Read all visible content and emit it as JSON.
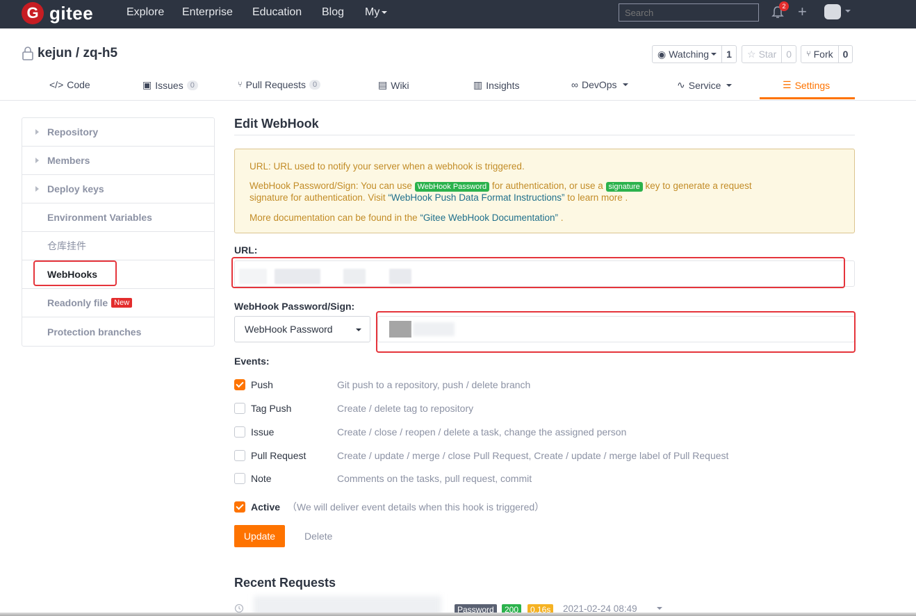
{
  "nav": {
    "logo_text": "gitee",
    "links": [
      "Explore",
      "Enterprise",
      "Education",
      "Blog",
      "My"
    ],
    "search_placeholder": "Search",
    "notification_count": "2"
  },
  "repo": {
    "owner": "kejun",
    "name": "zq-h5",
    "watching_label": "Watching",
    "watching_count": "1",
    "star_label": "Star",
    "star_count": "0",
    "fork_label": "Fork",
    "fork_count": "0"
  },
  "tabs": {
    "code": "Code",
    "issues": "Issues",
    "issues_count": "0",
    "pull_requests": "Pull Requests",
    "pr_count": "0",
    "wiki": "Wiki",
    "insights": "Insights",
    "devops": "DevOps",
    "service": "Service",
    "settings": "Settings"
  },
  "sidebar": {
    "items": [
      {
        "label": "Repository"
      },
      {
        "label": "Members"
      },
      {
        "label": "Deploy keys"
      },
      {
        "label": "Environment Variables"
      },
      {
        "label": "仓库挂件"
      },
      {
        "label": "WebHooks"
      },
      {
        "label": "Readonly file"
      },
      {
        "label": "Protection branches"
      }
    ],
    "new_badge": "New"
  },
  "main": {
    "title": "Edit WebHook",
    "notice": {
      "line1": "URL: URL used to notify your server when a webhook is triggered.",
      "line2_a": "WebHook Password/Sign: You can use",
      "line2_tag1": "WebHook Password",
      "line2_b": "for authentication, or use a",
      "line2_tag2": "signature",
      "line2_c": "key to generate a request",
      "line3_a": "signature for authentication. Visit",
      "line3_link": "“WebHook Push Data Format Instructions”",
      "line3_b": "to learn more .",
      "line4_a": "More documentation can be found in the",
      "line4_link": "“Gitee WebHook Documentation”",
      "line4_b": "."
    },
    "url_label": "URL:",
    "password_label": "WebHook Password/Sign:",
    "password_select": "WebHook Password",
    "events_label": "Events:",
    "events": [
      {
        "name": "Push",
        "desc": "Git push to a repository, push / delete branch",
        "checked": true
      },
      {
        "name": "Tag Push",
        "desc": "Create / delete tag to repository",
        "checked": false
      },
      {
        "name": "Issue",
        "desc": "Create / close / reopen / delete a task, change the assigned person",
        "checked": false
      },
      {
        "name": "Pull Request",
        "desc": "Create / update / merge / close Pull Request, Create / update / merge label of Pull Request",
        "checked": false
      },
      {
        "name": "Note",
        "desc": "Comments on the tasks, pull request, commit",
        "checked": false
      }
    ],
    "active_label": "Active",
    "active_hint": "（We will deliver event details when this hook is triggered）",
    "update_button": "Update",
    "delete_button": "Delete",
    "recent_title": "Recent Requests",
    "recent_request": {
      "auth": "Password",
      "status": "200",
      "duration": "0.16s",
      "time": "2021-02-24 08:49"
    }
  },
  "colors": {
    "nav_bg": "#2d3441",
    "accent": "#fe7300",
    "brand_red": "#c71d23",
    "highlight_box": "#e5343b",
    "status_green": "#2bb24c"
  }
}
